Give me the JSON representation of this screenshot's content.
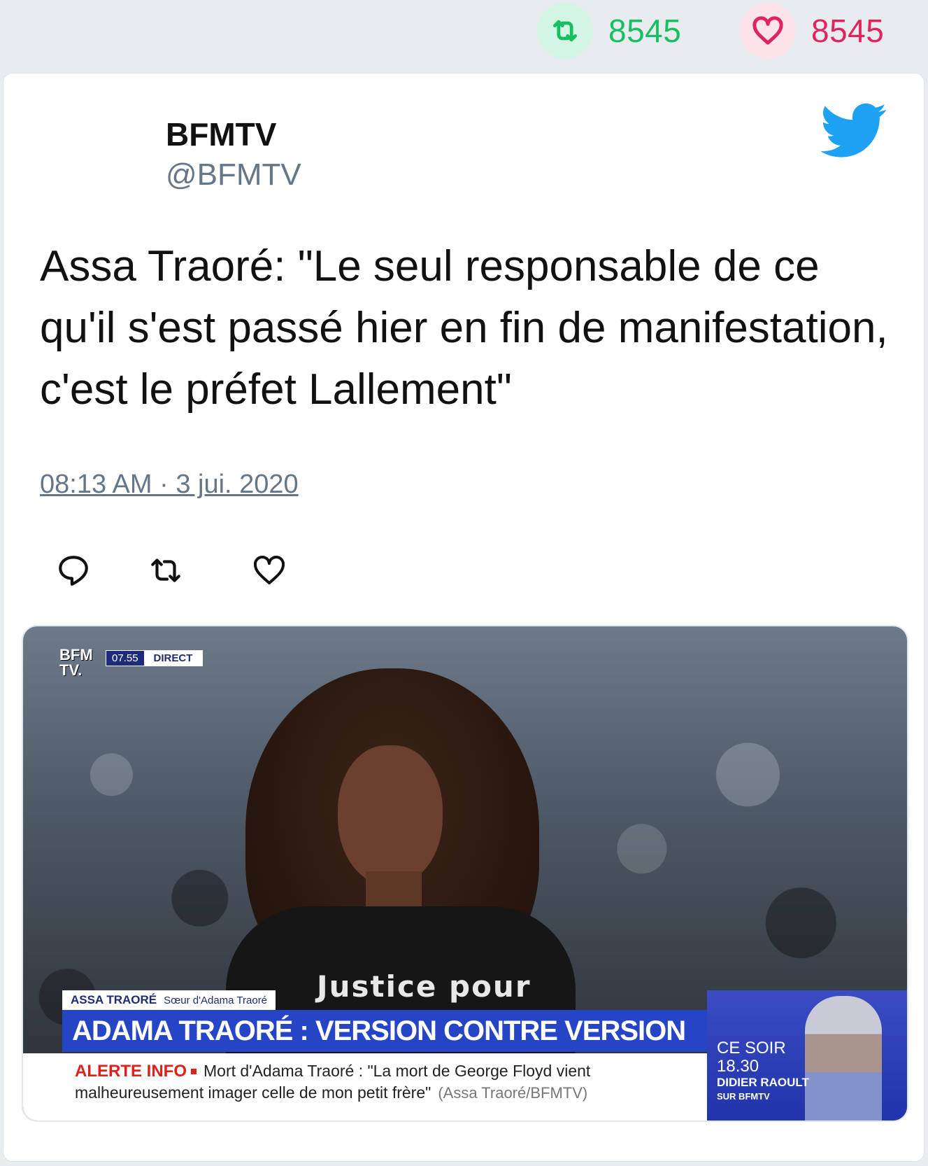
{
  "stats": {
    "retweets": "8545",
    "likes": "8545",
    "retweet_color": "#17bf63",
    "like_color": "#e0245e"
  },
  "tweet": {
    "author_name": "BFMTV",
    "author_handle": "@BFMTV",
    "text": "Assa Traoré: \"Le seul responsable de ce qu'il s'est passé hier en fin de manifestation, c'est le préfet Lallement\"",
    "timestamp": "08:13 AM · 3 jui. 2020",
    "brand_icon": "twitter-bird-icon",
    "brand_color": "#1da1f2"
  },
  "actions": {
    "reply_icon": "reply-icon",
    "retweet_icon": "retweet-icon",
    "like_icon": "heart-icon"
  },
  "media": {
    "logo_line1": "BFM",
    "logo_line2": "TV.",
    "live_time": "07.55",
    "live_label": "DIRECT",
    "shirt_text": "Justice pour",
    "name": "ASSA TRAORÉ",
    "role": "Sœur d'Adama Traoré",
    "headline": "ADAMA TRAORÉ : VERSION CONTRE VERSION",
    "alert_label": "ALERTE INFO",
    "alert_line1": "Mort d'Adama Traoré : \"La mort de George Floyd vient",
    "alert_line2": "malheureusement imager celle de mon petit frère\"",
    "alert_source": "(Assa Traoré/BFMTV)",
    "promo_line1": "CE SOIR",
    "promo_line2": "18.30",
    "promo_name": "DIDIER RAOULT",
    "promo_sub": "SUR BFMTV"
  }
}
